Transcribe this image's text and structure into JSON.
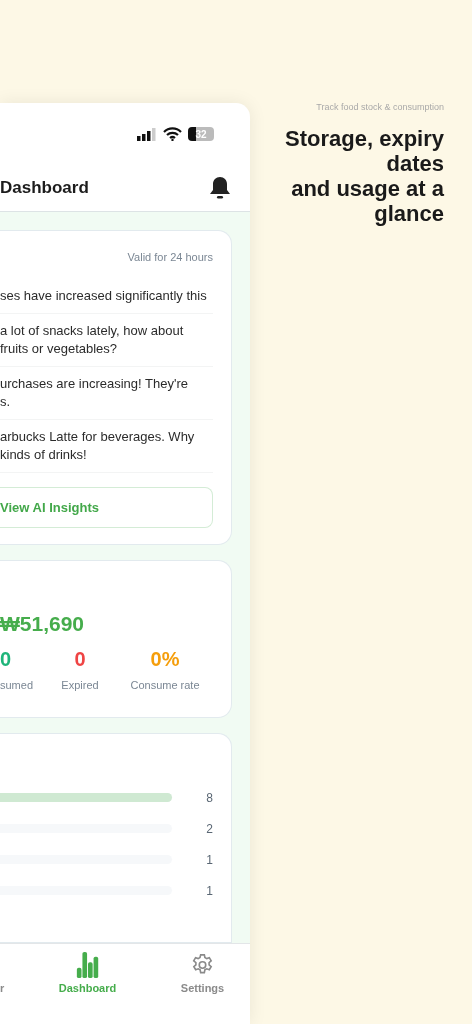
{
  "promo": {
    "caption": "Track food stock & consumption",
    "headline": [
      "Storage, expiry dates",
      "and usage at a glance"
    ]
  },
  "status_bar": {
    "battery": "32"
  },
  "header": {
    "title": "Dashboard"
  },
  "insights": {
    "validity": "Valid for 24 hours",
    "items": [
      [
        "ses have increased significantly this"
      ],
      [
        "a lot of snacks lately, how about",
        "fruits or vegetables?"
      ],
      [
        "urchases are increasing! They're",
        "s."
      ],
      [
        "arbucks Latte for beverages. Why",
        "kinds of drinks!"
      ]
    ],
    "button": "View AI Insights"
  },
  "summary": {
    "total": "₩51,690",
    "stats": [
      {
        "value": "0",
        "label": "sumed",
        "color": "#1fb57a"
      },
      {
        "value": "0",
        "label": "Expired",
        "color": "#ef4444"
      },
      {
        "value": "0%",
        "label": "Consume rate",
        "color": "#f59e0b"
      }
    ]
  },
  "bars": [
    {
      "count": "8",
      "level": 1
    },
    {
      "count": "2",
      "level": 0
    },
    {
      "count": "1",
      "level": 0
    },
    {
      "count": "1",
      "level": 0
    }
  ],
  "tabs": [
    {
      "label": "r",
      "selected": false,
      "kind": "plain"
    },
    {
      "label": "Dashboard",
      "selected": true,
      "kind": "chart"
    },
    {
      "label": "Settings",
      "selected": false,
      "kind": "gear"
    }
  ]
}
